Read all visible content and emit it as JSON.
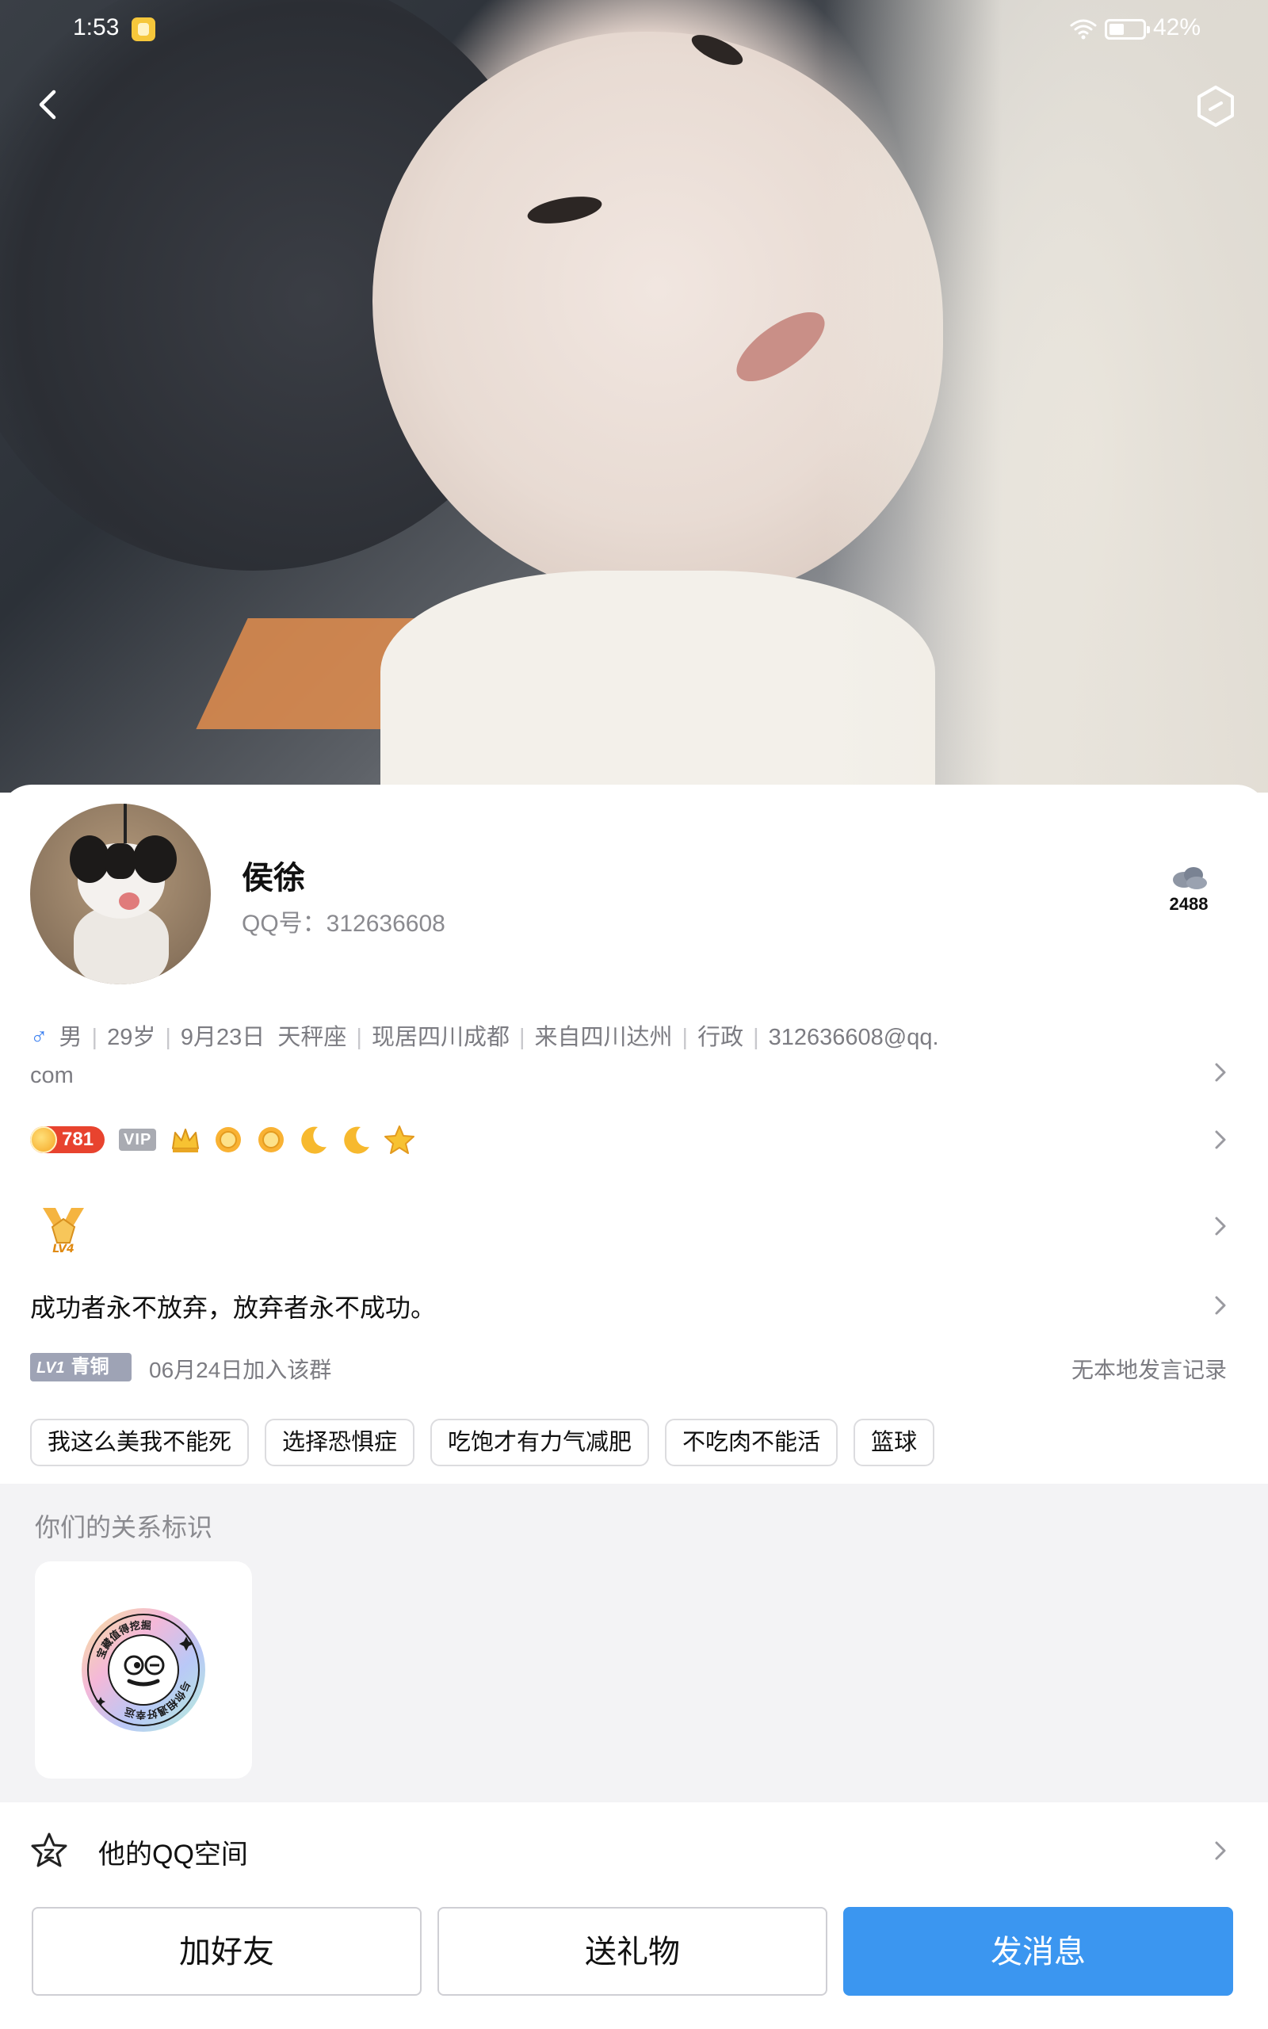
{
  "status_bar": {
    "time": "1:53",
    "battery": "42%"
  },
  "profile": {
    "name": "侯徐",
    "qq_id_label": "QQ号：312636608",
    "cloud_count": "2488",
    "info": {
      "gender": "男",
      "age": "29岁",
      "birthday": "9月23日",
      "zodiac": "天秤座",
      "location": "现居四川成都",
      "hometown": "来自四川达州",
      "job": "行政",
      "email_line1": "312636608@qq.",
      "email_line2": "com"
    },
    "coin_value": "781",
    "vip_label": "VIP",
    "level_icons": [
      "crown-icon",
      "sun-icon",
      "sun-icon",
      "moon-icon",
      "moon-icon",
      "star-icon"
    ],
    "medal_label": "LV4",
    "signature": "成功者永不放弃，放弃者永不成功。",
    "group": {
      "lv_prefix": "LV1",
      "lv_name": "青铜",
      "join_text": "06月24日加入该群",
      "record_text": "无本地发言记录"
    },
    "tags": [
      "我这么美我不能死",
      "选择恐惧症",
      "吃饱才有力气减肥",
      "不吃肉不能活",
      "篮球"
    ]
  },
  "relation": {
    "title": "你们的关系标识",
    "badge_text_top": "宝藏值得挖掘",
    "badge_text_bottom": "与你相遇好幸运"
  },
  "qzone": {
    "label": "他的QQ空间"
  },
  "actions": {
    "add_friend": "加好友",
    "send_gift": "送礼物",
    "send_message": "发消息"
  },
  "colors": {
    "primary": "#3b96f0",
    "coin": "#e8432e",
    "gender": "#3a7ff0"
  }
}
